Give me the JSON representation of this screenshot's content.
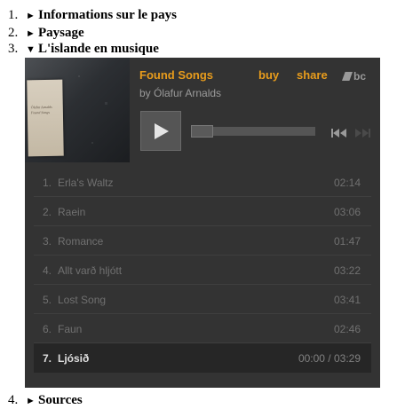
{
  "outline": [
    {
      "number": "1.",
      "arrow": "►",
      "label": "Informations sur le pays"
    },
    {
      "number": "2.",
      "arrow": "►",
      "label": "Paysage"
    },
    {
      "number": "3.",
      "arrow": "▼",
      "label": "L'islande en musique"
    },
    {
      "number": "4.",
      "arrow": "►",
      "label": "Sources"
    }
  ],
  "player": {
    "album_title": "Found Songs",
    "artist": "by Ólafur Arnalds",
    "buy_label": "buy",
    "share_label": "share",
    "logo_text": "bc",
    "cover_text_1": "Ólafur Arnalds",
    "cover_text_2": "Found Songs",
    "accent_color": "#e89c1c",
    "tracks": [
      {
        "number": "1.",
        "title": "Erla's Waltz",
        "time": "02:14"
      },
      {
        "number": "2.",
        "title": "Raein",
        "time": "03:06"
      },
      {
        "number": "3.",
        "title": "Romance",
        "time": "01:47"
      },
      {
        "number": "4.",
        "title": "Allt varð hljótt",
        "time": "03:22"
      },
      {
        "number": "5.",
        "title": "Lost Song",
        "time": "03:41"
      },
      {
        "number": "6.",
        "title": "Faun",
        "time": "02:46"
      },
      {
        "number": "7.",
        "title": "Ljósið",
        "time": "00:00 / 03:29"
      }
    ],
    "current_track_index": 6,
    "progress_fraction": 0.0
  }
}
